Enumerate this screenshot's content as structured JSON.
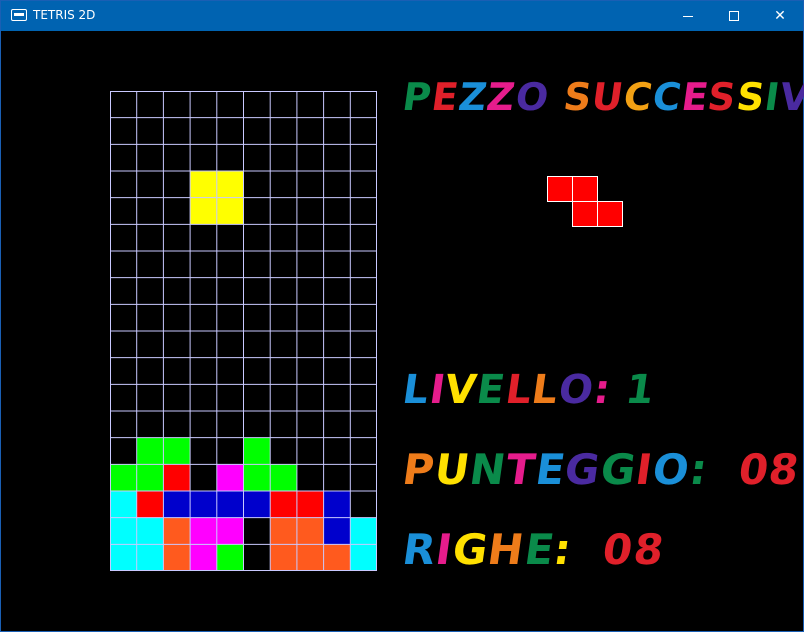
{
  "window": {
    "title": "TETRIS 2D",
    "minimize_glyph": "—",
    "maximize_glyph": "☐",
    "close_glyph": "✕"
  },
  "board": {
    "columns": 10,
    "rows": 18,
    "grid_color": "#c9c9ff",
    "background": "#000000",
    "cells": [
      "..........",
      "..........",
      "..........",
      "...YY.....",
      "...YY.....",
      "..........",
      "..........",
      "..........",
      "..........",
      "..........",
      "..........",
      "..........",
      "..........",
      ".GG..G....",
      "GGR.MGG...",
      "CRBBBBRRB.",
      "CCOMM.OOBC",
      "CCOMG.OOOC"
    ],
    "palette": {
      "Y": "#ffff00",
      "G": "#00ff00",
      "R": "#ff0000",
      "M": "#ff00ff",
      "C": "#00ffff",
      "B": "#0000cc",
      "O": "#ff5a1e"
    }
  },
  "next_piece": {
    "name": "Z",
    "color": "#ff0000",
    "shape": [
      "RR.",
      ".RR"
    ]
  },
  "labels": {
    "next": "PEZZO SUCCESSIVO:",
    "level": "LIVELLO:",
    "level_value": "1",
    "score": "PUNTEGGIO:",
    "score_value": "08",
    "lines": "RIGHE:",
    "lines_value": "08"
  },
  "label_colors": {
    "next": [
      "#0a8a4a",
      "#e0202a",
      "#1a8fd8",
      "#e61c8c",
      "#4a2aa0",
      " ",
      "#ee7c1a",
      "#e0202a",
      "#f2a114",
      "#1a8fd8",
      "#e61c8c",
      "#e0202a",
      "#ffe000",
      "#0a8a4a",
      "#4a2aa0",
      "#4a2aa0",
      "#e0202a"
    ],
    "level": [
      "#1a8fd8",
      "#e61c8c",
      "#ffe000",
      "#0a8a4a",
      "#e0202a",
      "#ee7c1a",
      "#4a2aa0",
      "#e61c8c",
      " ",
      "#0a8a4a"
    ],
    "score": [
      "#ee7c1a",
      "#ffe000",
      "#0a8a4a",
      "#e61c8c",
      "#1a8fd8",
      "#4a2aa0",
      "#0a8a4a",
      "#e0202a",
      "#1a8fd8",
      "#0a8a4a",
      " ",
      " ",
      "#e0202a",
      "#e0202a"
    ],
    "lines": [
      "#1a8fd8",
      "#e61c8c",
      "#ffe000",
      "#ee7c1a",
      "#0a8a4a",
      "#ffe000",
      " ",
      " ",
      "#e0202a",
      "#e0202a"
    ]
  }
}
